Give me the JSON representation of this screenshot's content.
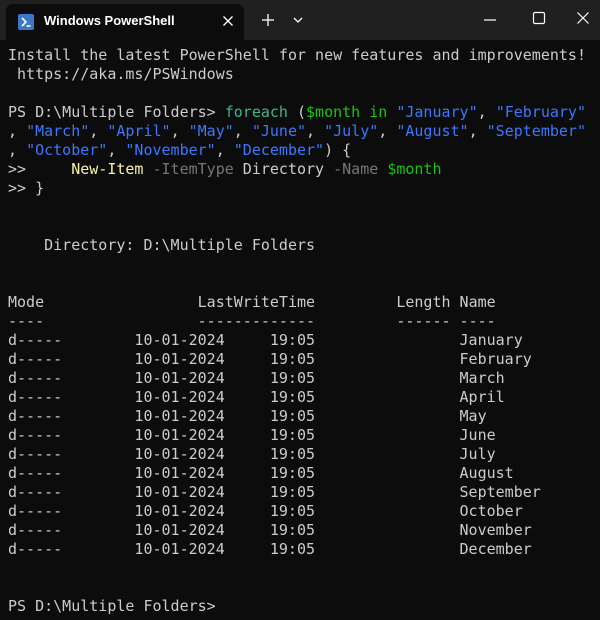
{
  "window": {
    "tab_title": "Windows PowerShell",
    "icons": {
      "tab_icon": "powershell-icon",
      "tab_close": "close-icon",
      "new_tab": "plus-icon",
      "tab_menu": "chevron-down-icon",
      "minimize": "minimize-icon",
      "maximize": "maximize-icon",
      "close": "close-icon"
    },
    "colors": {
      "titlebar": "#202020",
      "tab": "#0c0c0c",
      "background": "#0c0c0c",
      "text": "#cccccc",
      "keyword": "#f9f1a5",
      "variable": "#16c60c",
      "string": "#3b78ff",
      "parameter": "#767676"
    }
  },
  "terminal": {
    "banner_line1": "Install the latest PowerShell for new features and improvements!",
    "banner_line2": " https://aka.ms/PSWindows",
    "prompt": "PS D:\\Multiple Folders> ",
    "cmd": {
      "foreach": "foreach",
      "paren_open": " (",
      "var_month": "$month",
      "in": " in ",
      "january": "\"January\"",
      "comma": ", ",
      "february": "\"February\"",
      "wrap1_comma": ", ",
      "march": "\"March\"",
      "april": "\"April\"",
      "may": "\"May\"",
      "june": "\"June\"",
      "july": "\"July\"",
      "august": "\"August\"",
      "september": "\"September\"",
      "wrap2_comma": ", ",
      "october": "\"October\"",
      "november": "\"November\"",
      "december": "\"December\"",
      "paren_close": ") {",
      "cont_prompt": ">>     ",
      "new_item": "New-Item",
      "space": " ",
      "itemtype_param": "-ItemType",
      "directory_arg": " Directory ",
      "name_param": "-Name",
      "var_month2": "$month",
      "close_line": ">> }"
    },
    "directory_header": "    Directory: D:\\Multiple Folders",
    "table_header": "Mode                 LastWriteTime         Length Name",
    "table_underline": "----                 -------------         ------ ----",
    "rows": [
      {
        "mode": "d-----",
        "date": "10-01-2024",
        "time": "19:05",
        "name": "January"
      },
      {
        "mode": "d-----",
        "date": "10-01-2024",
        "time": "19:05",
        "name": "February"
      },
      {
        "mode": "d-----",
        "date": "10-01-2024",
        "time": "19:05",
        "name": "March"
      },
      {
        "mode": "d-----",
        "date": "10-01-2024",
        "time": "19:05",
        "name": "April"
      },
      {
        "mode": "d-----",
        "date": "10-01-2024",
        "time": "19:05",
        "name": "May"
      },
      {
        "mode": "d-----",
        "date": "10-01-2024",
        "time": "19:05",
        "name": "June"
      },
      {
        "mode": "d-----",
        "date": "10-01-2024",
        "time": "19:05",
        "name": "July"
      },
      {
        "mode": "d-----",
        "date": "10-01-2024",
        "time": "19:05",
        "name": "August"
      },
      {
        "mode": "d-----",
        "date": "10-01-2024",
        "time": "19:05",
        "name": "September"
      },
      {
        "mode": "d-----",
        "date": "10-01-2024",
        "time": "19:05",
        "name": "October"
      },
      {
        "mode": "d-----",
        "date": "10-01-2024",
        "time": "19:05",
        "name": "November"
      },
      {
        "mode": "d-----",
        "date": "10-01-2024",
        "time": "19:05",
        "name": "December"
      }
    ],
    "final_prompt": "PS D:\\Multiple Folders>"
  }
}
